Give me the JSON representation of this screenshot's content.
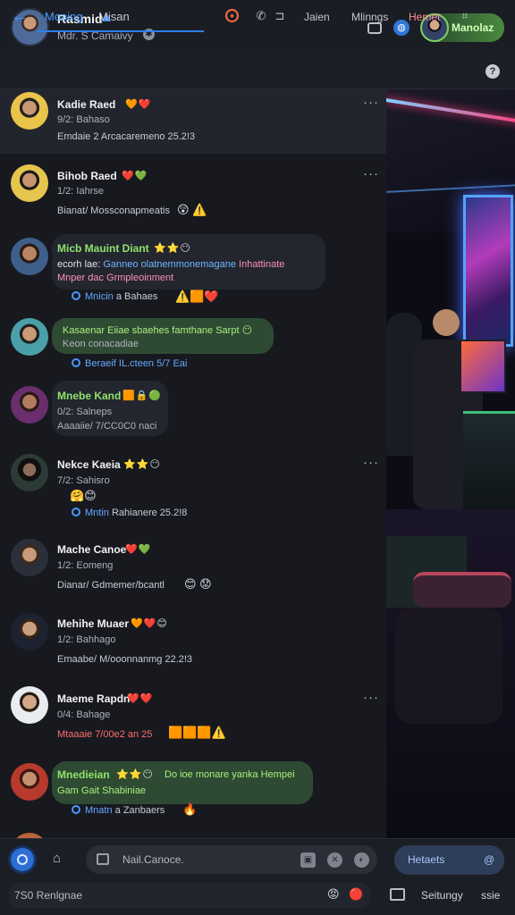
{
  "header": {
    "user_name": "Rasmid",
    "user_status": "Mdr. S Camaivy",
    "friend_label": "Manolaz"
  },
  "toolbar": {
    "tabs": [
      {
        "label": "Moaing",
        "active": true
      },
      {
        "label": "Misan",
        "active": false
      }
    ],
    "links": [
      "Jaien",
      "Mlinngs",
      "Hemet"
    ]
  },
  "feed": {
    "posts": [
      {
        "name": "Kadie Raed",
        "name_emoji": "🧡❤️",
        "sub": "9/2: Bahaso",
        "meta": "Emdaie 2 Arcacaremeno 25.2!3"
      },
      {
        "name": "Bihob Raed",
        "name_emoji": "❤️💚",
        "sub": "1/2: Iahrse",
        "meta": "Bianat/ Mossconapmeatis",
        "meta_emoji": "😲 ⚠️"
      },
      {
        "name": "Micb Mauint Diant",
        "name_emoji": "⭐⭐😶",
        "bubble_lines": [
          {
            "parts": [
              {
                "text": "ecorh lae:",
                "color": "b-white"
              },
              {
                "text": " Ganneo olatnemmonemagane",
                "color": "b-blue"
              },
              {
                "text": " Inhattinate",
                "color": "b-pink"
              }
            ]
          },
          {
            "parts": [
              {
                "text": "Mnper dac Grmpleoinment",
                "color": "b-pink"
              }
            ]
          }
        ],
        "link": "Mnicin",
        "link_sub": "a  Bahaes",
        "link_emoji": "⚠️🟧❤️"
      },
      {
        "name": "",
        "bubble_lines": [
          {
            "parts": [
              {
                "text": "Kasaenar Eiiae sbaehes famthane Sarpt",
                "color": "b-green"
              },
              {
                "text": " 😶",
                "color": "b-green"
              }
            ]
          },
          {
            "parts": [
              {
                "text": "Keon conacadiae",
                "color": "b-muted"
              }
            ]
          }
        ],
        "link": "Beraeif IL.cteen 5/7 Eai"
      },
      {
        "name": "Mnebe Kand",
        "name_emoji": "🟧🔒🟢",
        "sub": "0/2: Salneps",
        "meta": "Aaaaiie/ 7/CC0C0 naci"
      },
      {
        "name": "Nekce Kaeia",
        "name_emoji": "⭐⭐😶",
        "sub": "7/2: Sahisro",
        "sub_emoji": "🤗😊",
        "link": "Mntin",
        "link_sub": "Rahianere 25.2!8"
      },
      {
        "name": "Mache Canoe",
        "name_emoji": "❤️💚",
        "sub": "1/2: Eomeng",
        "meta": "Dianar/ Gdmemer/bcantl",
        "meta_emoji": "😊 😟"
      },
      {
        "name": "Mehihe Muaer",
        "name_emoji": "🧡❤️😊",
        "sub": "1/2: Bahhago",
        "meta": "Emaabe/ M/ooonnanmg 22.2!3"
      },
      {
        "name": "Maeme Rapdn",
        "name_emoji": "❤️❤️",
        "sub": "0/4: Bahage",
        "meta": "Mtaaaie 7/00e2 an 25",
        "meta_emoji": "🟧🟧🟧⚠️"
      },
      {
        "name": "Mnedieian",
        "name_emoji": "⭐⭐😶",
        "name_tail": "Do ioe monare yanka Hempei",
        "bubble_lines": [
          {
            "parts": [
              {
                "text": "Gam Gait Shabiniae",
                "color": "b-green"
              }
            ]
          }
        ],
        "link": "Mnatn",
        "link_sub": "a  Zanbaers",
        "link_emoji": "🔥"
      }
    ]
  },
  "composer": {
    "placeholder": "Nail.Canoce.",
    "send_label": "Hetaets",
    "status_text": "7S0 Renlgnae",
    "settings_label": "Seitungy",
    "more_label": "ssie"
  }
}
